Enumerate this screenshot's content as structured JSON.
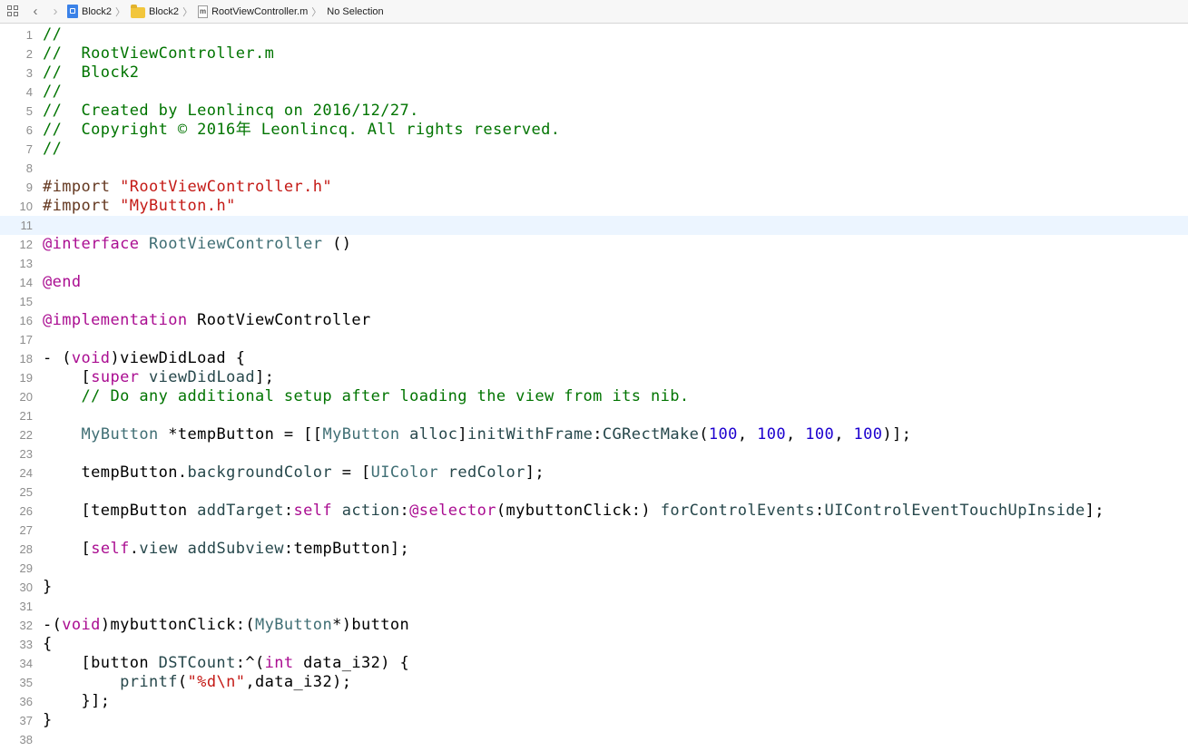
{
  "jumpbar": {
    "crumbs": [
      {
        "label": "Block2",
        "icon": "project-icon"
      },
      {
        "label": "Block2",
        "icon": "folder-icon"
      },
      {
        "label": "RootViewController.m",
        "icon": "objc-file-icon"
      },
      {
        "label": "No Selection",
        "icon": ""
      }
    ],
    "file_icon_glyph": "m",
    "back_glyph": "‹",
    "forward_glyph": "›",
    "separator_glyph": "〉"
  },
  "colors": {
    "comment": "#007400",
    "preprocessor": "#643820",
    "string": "#c41a16",
    "keyword": "#aa0d91",
    "class": "#3f6e74",
    "method": "#26474b",
    "number": "#1c00cf",
    "current_line": "#ecf5ff"
  },
  "editor": {
    "current_line": 11,
    "lines": [
      {
        "n": "1",
        "tokens": [
          [
            "com",
            "//"
          ]
        ]
      },
      {
        "n": "2",
        "tokens": [
          [
            "com",
            "//  RootViewController.m"
          ]
        ]
      },
      {
        "n": "3",
        "tokens": [
          [
            "com",
            "//  Block2"
          ]
        ]
      },
      {
        "n": "4",
        "tokens": [
          [
            "com",
            "//"
          ]
        ]
      },
      {
        "n": "5",
        "tokens": [
          [
            "com",
            "//  Created by Leonlincq on 2016/12/27."
          ]
        ]
      },
      {
        "n": "6",
        "tokens": [
          [
            "com",
            "//  Copyright © 2016年 Leonlincq. All rights reserved."
          ]
        ]
      },
      {
        "n": "7",
        "tokens": [
          [
            "com",
            "//"
          ]
        ]
      },
      {
        "n": "8",
        "tokens": []
      },
      {
        "n": "9",
        "tokens": [
          [
            "pre",
            "#import "
          ],
          [
            "str",
            "\"RootViewController.h\""
          ]
        ]
      },
      {
        "n": "10",
        "tokens": [
          [
            "pre",
            "#import "
          ],
          [
            "str",
            "\"MyButton.h\""
          ]
        ]
      },
      {
        "n": "11",
        "tokens": []
      },
      {
        "n": "12",
        "tokens": [
          [
            "kw",
            "@interface"
          ],
          [
            "plain",
            " "
          ],
          [
            "cls",
            "RootViewController"
          ],
          [
            "plain",
            " ()"
          ]
        ]
      },
      {
        "n": "13",
        "tokens": []
      },
      {
        "n": "14",
        "tokens": [
          [
            "kw",
            "@end"
          ]
        ]
      },
      {
        "n": "15",
        "tokens": []
      },
      {
        "n": "16",
        "tokens": [
          [
            "kw",
            "@implementation"
          ],
          [
            "plain",
            " RootViewController"
          ]
        ]
      },
      {
        "n": "17",
        "tokens": []
      },
      {
        "n": "18",
        "tokens": [
          [
            "plain",
            "- ("
          ],
          [
            "kw",
            "void"
          ],
          [
            "plain",
            ")viewDidLoad {"
          ]
        ]
      },
      {
        "n": "19",
        "tokens": [
          [
            "plain",
            "    ["
          ],
          [
            "kw",
            "super"
          ],
          [
            "plain",
            " "
          ],
          [
            "mth",
            "viewDidLoad"
          ],
          [
            "plain",
            "];"
          ]
        ]
      },
      {
        "n": "20",
        "tokens": [
          [
            "com",
            "    // Do any additional setup after loading the view from its nib."
          ]
        ]
      },
      {
        "n": "21",
        "tokens": []
      },
      {
        "n": "22",
        "tokens": [
          [
            "plain",
            "    "
          ],
          [
            "cls",
            "MyButton"
          ],
          [
            "plain",
            " *tempButton = [["
          ],
          [
            "cls",
            "MyButton"
          ],
          [
            "plain",
            " "
          ],
          [
            "mth",
            "alloc"
          ],
          [
            "plain",
            "]"
          ],
          [
            "mth",
            "initWithFrame"
          ],
          [
            "plain",
            ":"
          ],
          [
            "mth",
            "CGRectMake"
          ],
          [
            "plain",
            "("
          ],
          [
            "num",
            "100"
          ],
          [
            "plain",
            ", "
          ],
          [
            "num",
            "100"
          ],
          [
            "plain",
            ", "
          ],
          [
            "num",
            "100"
          ],
          [
            "plain",
            ", "
          ],
          [
            "num",
            "100"
          ],
          [
            "plain",
            ")];"
          ]
        ]
      },
      {
        "n": "23",
        "tokens": []
      },
      {
        "n": "24",
        "tokens": [
          [
            "plain",
            "    tempButton."
          ],
          [
            "mth",
            "backgroundColor"
          ],
          [
            "plain",
            " = ["
          ],
          [
            "cls",
            "UIColor"
          ],
          [
            "plain",
            " "
          ],
          [
            "mth",
            "redColor"
          ],
          [
            "plain",
            "];"
          ]
        ]
      },
      {
        "n": "25",
        "tokens": []
      },
      {
        "n": "26",
        "tokens": [
          [
            "plain",
            "    [tempButton "
          ],
          [
            "mth",
            "addTarget"
          ],
          [
            "plain",
            ":"
          ],
          [
            "kw",
            "self"
          ],
          [
            "plain",
            " "
          ],
          [
            "mth",
            "action"
          ],
          [
            "plain",
            ":"
          ],
          [
            "kw",
            "@selector"
          ],
          [
            "plain",
            "(mybuttonClick:) "
          ],
          [
            "mth",
            "forControlEvents"
          ],
          [
            "plain",
            ":"
          ],
          [
            "mth",
            "UIControlEventTouchUpInside"
          ],
          [
            "plain",
            "];"
          ]
        ]
      },
      {
        "n": "27",
        "tokens": []
      },
      {
        "n": "28",
        "tokens": [
          [
            "plain",
            "    ["
          ],
          [
            "kw",
            "self"
          ],
          [
            "plain",
            "."
          ],
          [
            "mth",
            "view"
          ],
          [
            "plain",
            " "
          ],
          [
            "mth",
            "addSubview"
          ],
          [
            "plain",
            ":tempButton];"
          ]
        ]
      },
      {
        "n": "29",
        "tokens": []
      },
      {
        "n": "30",
        "tokens": [
          [
            "plain",
            "}"
          ]
        ]
      },
      {
        "n": "31",
        "tokens": []
      },
      {
        "n": "32",
        "tokens": [
          [
            "plain",
            "-("
          ],
          [
            "kw",
            "void"
          ],
          [
            "plain",
            ")mybuttonClick:("
          ],
          [
            "cls",
            "MyButton"
          ],
          [
            "plain",
            "*)button"
          ]
        ]
      },
      {
        "n": "33",
        "tokens": [
          [
            "plain",
            "{"
          ]
        ]
      },
      {
        "n": "34",
        "tokens": [
          [
            "plain",
            "    [button "
          ],
          [
            "mth",
            "DSTCount"
          ],
          [
            "plain",
            ":^("
          ],
          [
            "kw",
            "int"
          ],
          [
            "plain",
            " data_i32) {"
          ]
        ]
      },
      {
        "n": "35",
        "tokens": [
          [
            "plain",
            "        "
          ],
          [
            "mth",
            "printf"
          ],
          [
            "plain",
            "("
          ],
          [
            "str",
            "\"%d\\n\""
          ],
          [
            "plain",
            ",data_i32);"
          ]
        ]
      },
      {
        "n": "36",
        "tokens": [
          [
            "plain",
            "    }];"
          ]
        ]
      },
      {
        "n": "37",
        "tokens": [
          [
            "plain",
            "}"
          ]
        ]
      },
      {
        "n": "38",
        "tokens": []
      }
    ]
  }
}
